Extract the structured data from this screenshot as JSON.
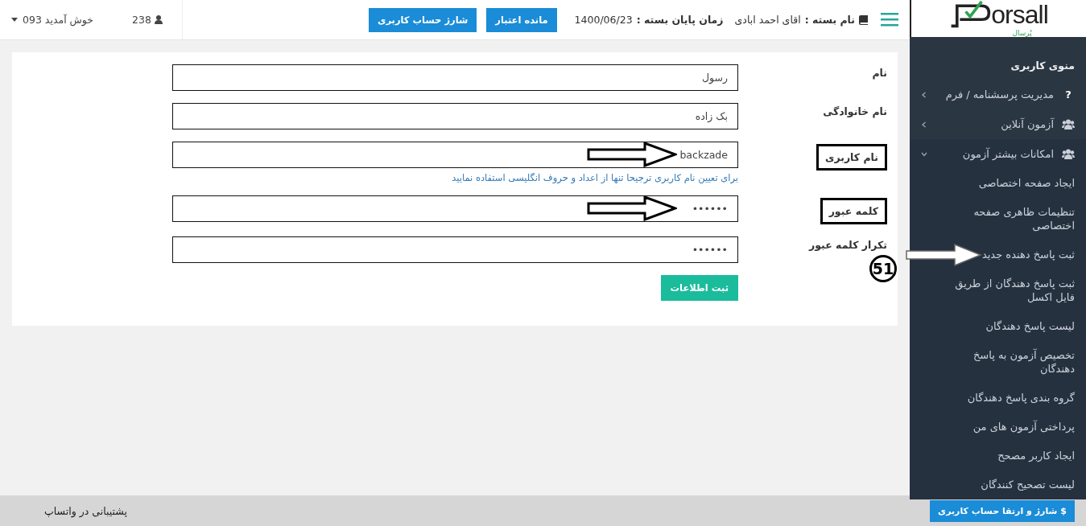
{
  "logo": {
    "wordmark": "orsall",
    "subtitle": "پُرسال"
  },
  "header": {
    "package_label": "نام بسته :",
    "package_name": "اقای احمد ابادی",
    "end_label": "زمان پایان بسته :",
    "end_date": "1400/06/23",
    "buttons": [
      "مانده اعتبار",
      "شارژ حساب کاربری"
    ],
    "count": "238",
    "welcome": "093 خوش آمدید"
  },
  "sidebar": {
    "title": "منوی کاربری",
    "items": [
      {
        "label": "مدیریت پرسشنامه / فرم",
        "kind": "question",
        "glyph": "?",
        "expanded": false
      },
      {
        "label": "آزمون آنلاین",
        "kind": "users",
        "expanded": false
      },
      {
        "label": "امکانات بیشتر آزمون",
        "kind": "users",
        "expanded": true,
        "children": [
          {
            "label": "ایجاد صفحه اختصاصی",
            "pointer_arrow": false
          },
          {
            "label": "تنظیمات ظاهری صفحه اختصاصی",
            "pointer_arrow": false
          },
          {
            "label": "ثبت پاسخ دهنده جدید",
            "pointer_arrow": true
          },
          {
            "label": "ثبت پاسخ دهندگان از طریق فایل اکسل",
            "pointer_arrow": false
          },
          {
            "label": "لیست پاسخ دهندگان",
            "pointer_arrow": false
          },
          {
            "label": "تخصیص آزمون به پاسخ دهندگان",
            "pointer_arrow": false
          },
          {
            "label": "گروه بندی پاسخ دهندگان",
            "pointer_arrow": false
          },
          {
            "label": "پرداختی آزمون های من",
            "pointer_arrow": false
          },
          {
            "label": "ایجاد کاربر مصحح",
            "pointer_arrow": false
          },
          {
            "label": "لیست تصحیح کنندگان",
            "pointer_arrow": false
          }
        ]
      }
    ]
  },
  "form": {
    "fields": [
      {
        "label": "نام",
        "value": "رسول",
        "highlighted": false,
        "pointer_arrow": false
      },
      {
        "label": "نام خانوادگی",
        "value": "بک زاده",
        "highlighted": false,
        "pointer_arrow": false
      },
      {
        "label": "نام کاربری",
        "value": "backzade",
        "highlighted": true,
        "pointer_arrow": true,
        "hint": "برای تعیین نام کاربری ترجیحا تنها از اعداد و حروف انگلیسی استفاده نمایید"
      },
      {
        "label": "کلمه عبور",
        "value": "••••••",
        "highlighted": true,
        "pointer_arrow": true
      },
      {
        "label": "تکرار کلمه عبور",
        "value": "••••••",
        "highlighted": false,
        "pointer_arrow": false
      }
    ],
    "submit": "ثبت اطلاعات"
  },
  "annotations": {
    "step_number": "51"
  },
  "footer": {
    "support": "پشتیبانی در واتساپ",
    "upgrade_icon": "$",
    "upgrade_button": "شارژ و ارتقا حساب کاربری"
  }
}
